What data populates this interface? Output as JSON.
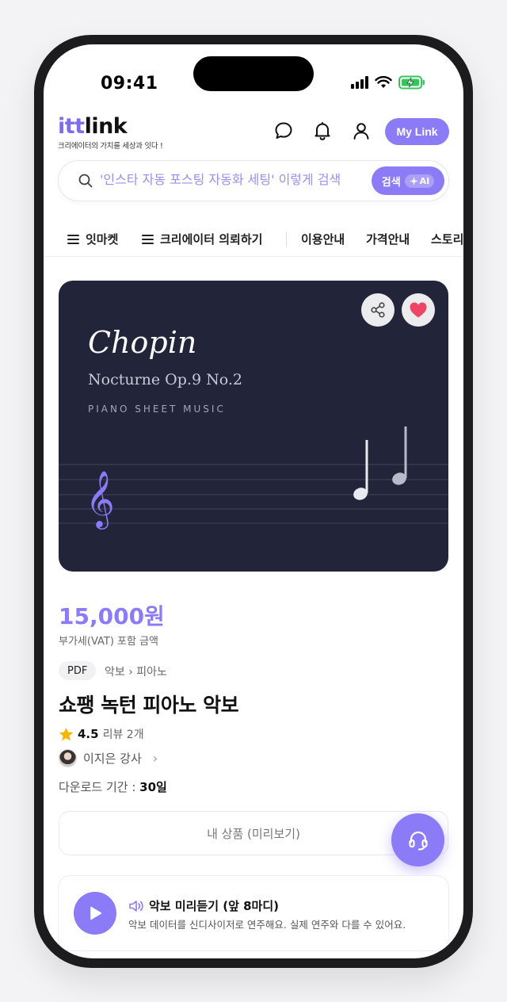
{
  "status": {
    "time": "09:41"
  },
  "header": {
    "logo_prefix": "itt",
    "logo_suffix": "link",
    "tagline": "크리에이터의 가치를 세상과 잇다 !",
    "mylink_label": "My Link"
  },
  "search": {
    "placeholder": "'인스타 자동 포스팅 자동화 세팅' 이렇게 검색",
    "button_label": "검색",
    "ai_label": "AI"
  },
  "nav": {
    "items": [
      "잇마켓",
      "크리에이터 의뢰하기",
      "이용안내",
      "가격안내",
      "스토리"
    ]
  },
  "hero": {
    "title": "Chopin",
    "subtitle": "Nocturne Op.9 No.2",
    "label": "PIANO SHEET MUSIC"
  },
  "product": {
    "price": "15,000원",
    "vat_note": "부가세(VAT) 포함 금액",
    "format_badge": "PDF",
    "category": "악보 › 피아노",
    "title": "쇼팽 녹턴 피아노 악보",
    "rating": "4.5",
    "reviews": "리뷰 2개",
    "seller": "이지은 강사",
    "download_label": "다운로드 기간 : ",
    "download_value": "30일",
    "preview_button": "내 상품 (미리보기)"
  },
  "listen": {
    "title": "악보 미리듣기 (앞 8마디)",
    "description": "악보 데이터를 신디사이저로 연주해요. 실제 연주와 다를 수 있어요."
  },
  "colors": {
    "accent": "#8b7bf6",
    "hero_bg": "#22243a",
    "heart": "#ef4565"
  },
  "icons": [
    "search-icon",
    "chat-icon",
    "bell-icon",
    "user-icon",
    "share-icon",
    "heart-icon",
    "star-icon",
    "headset-icon",
    "play-icon",
    "speaker-icon",
    "treble-clef-icon"
  ]
}
